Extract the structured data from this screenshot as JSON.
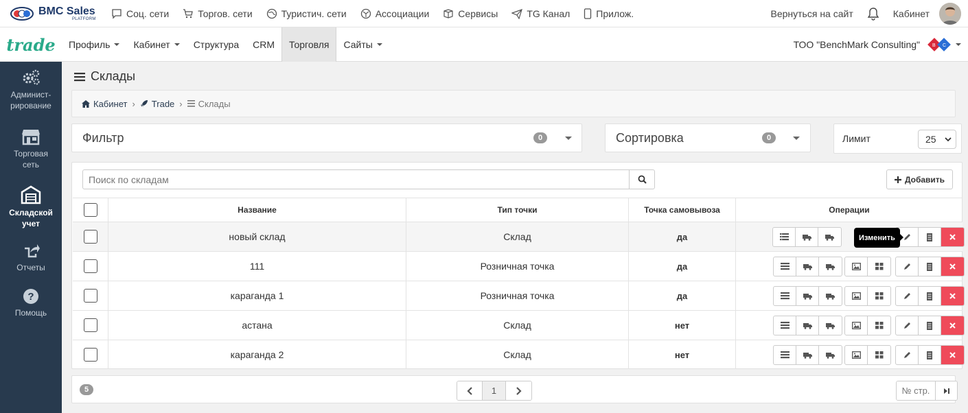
{
  "topbar": {
    "brand_title": "BMC Sales",
    "brand_sub": "PLATFORM",
    "logo_text": "BMC",
    "nav": [
      {
        "label": "Соц. сети",
        "icon": "chat-icon"
      },
      {
        "label": "Торгов. сети",
        "icon": "cart-icon"
      },
      {
        "label": "Туристич. сети",
        "icon": "globe-icon"
      },
      {
        "label": "Ассоциации",
        "icon": "network-icon"
      },
      {
        "label": "Сервисы",
        "icon": "box-icon"
      },
      {
        "label": "TG Канал",
        "icon": "send-icon"
      },
      {
        "label": "Прилож.",
        "icon": "phone-icon"
      }
    ],
    "back_link": "Вернуться на сайт",
    "cabinet": "Кабинет"
  },
  "navbar": {
    "logo": "trade",
    "items": [
      {
        "label": "Профиль",
        "dropdown": true
      },
      {
        "label": "Кабинет",
        "dropdown": true
      },
      {
        "label": "Структура",
        "dropdown": false
      },
      {
        "label": "CRM",
        "dropdown": false
      },
      {
        "label": "Торговля",
        "dropdown": false,
        "active": true
      },
      {
        "label": "Сайты",
        "dropdown": true
      }
    ],
    "company": "ТОО \"BenchMark Consulting\""
  },
  "sidebar": {
    "items": [
      {
        "label": "Админист-рирование",
        "icon": "gears-icon"
      },
      {
        "label": "Торговая сеть",
        "icon": "store-icon"
      },
      {
        "label": "Складской учет",
        "icon": "warehouse-icon",
        "active": true
      },
      {
        "label": "Отчеты",
        "icon": "share-icon"
      },
      {
        "label": "Помощь",
        "icon": "help-icon"
      }
    ]
  },
  "page": {
    "title": "Склады",
    "breadcrumb": [
      "Кабинет",
      "Trade",
      "Склады"
    ]
  },
  "filter": {
    "title": "Фильтр",
    "count": "0"
  },
  "sort": {
    "title": "Сортировка",
    "count": "0"
  },
  "limit": {
    "label": "Лимит",
    "value": "25"
  },
  "search": {
    "placeholder": "Поиск по складам"
  },
  "add_button": "Добавить",
  "table": {
    "columns": [
      "Название",
      "Тип точки",
      "Точка самовывоза",
      "Операции"
    ],
    "rows": [
      {
        "name": "новый склад",
        "type": "Склад",
        "pickup": "да"
      },
      {
        "name": "111",
        "type": "Розничная точка",
        "pickup": "да"
      },
      {
        "name": "караганда 1",
        "type": "Розничная точка",
        "pickup": "да"
      },
      {
        "name": "астана",
        "type": "Склад",
        "pickup": "нет"
      },
      {
        "name": "караганда 2",
        "type": "Склад",
        "pickup": "нет"
      }
    ]
  },
  "tooltip": "Изменить",
  "pager": {
    "total": "5",
    "current_page": "1",
    "page_no_label": "№ стр."
  },
  "colors": {
    "sidebar": "#283a4e",
    "accent_green": "#2aaa8a",
    "danger": "#ef4b5a"
  }
}
